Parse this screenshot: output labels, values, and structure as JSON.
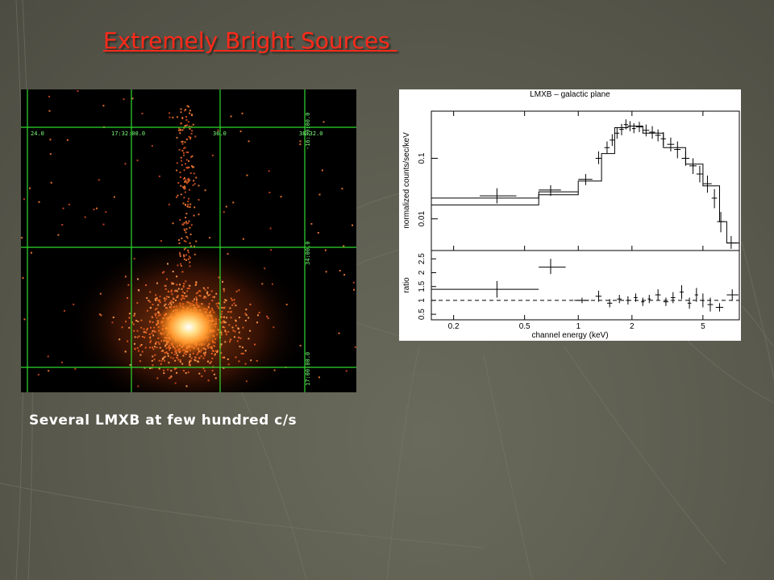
{
  "slide": {
    "title": "Extremely Bright Sources ",
    "caption": "Several LMXB at few hundred c/s",
    "colors": {
      "title": "#ff2a1a",
      "caption": "#ffffff",
      "background": "#5a5a4e",
      "grid": "#2ed82e"
    }
  },
  "xray_image": {
    "top_labels": [
      "24.0",
      "17:32:00.0",
      "36.0",
      "38:32.0"
    ],
    "right_labels": [
      "-16:30:00.0",
      "34:00.0",
      "17:00:00.0"
    ]
  },
  "chart_data": {
    "type": "scatter",
    "title": "LMXB – galactic plane",
    "xlabel": "channel energy (keV)",
    "upper_panel": {
      "ylabel": "normalized counts/sec/keV",
      "yscale": "log",
      "ylim": [
        0.003,
        0.6
      ],
      "ytick_labels": [
        "0.01",
        "0.1"
      ],
      "xlim": [
        0.15,
        8
      ],
      "xscale": "log",
      "model_step_1": [
        {
          "x0": 0.15,
          "x1": 0.6,
          "y": 0.017
        },
        {
          "x0": 0.6,
          "x1": 1.0,
          "y": 0.025
        },
        {
          "x0": 1.0,
          "x1": 1.35,
          "y": 0.042
        },
        {
          "x0": 1.35,
          "x1": 1.6,
          "y": 0.12
        },
        {
          "x0": 1.6,
          "x1": 1.9,
          "y": 0.32
        },
        {
          "x0": 1.9,
          "x1": 2.3,
          "y": 0.34
        },
        {
          "x0": 2.3,
          "x1": 3.0,
          "y": 0.26
        },
        {
          "x0": 3.0,
          "x1": 4.0,
          "y": 0.15
        },
        {
          "x0": 4.0,
          "x1": 5.0,
          "y": 0.08
        },
        {
          "x0": 5.0,
          "x1": 6.2,
          "y": 0.035
        },
        {
          "x0": 6.2,
          "x1": 6.8,
          "y": 0.009
        },
        {
          "x0": 6.8,
          "x1": 8.0,
          "y": 0.004
        }
      ],
      "model_step_2": [
        {
          "x0": 0.15,
          "x1": 0.6,
          "y": 0.022
        },
        {
          "x0": 0.6,
          "x1": 1.0,
          "y": 0.028
        }
      ],
      "points": [
        {
          "x": 0.35,
          "y": 0.024,
          "xerr": [
            0.28,
            0.45
          ],
          "yerr": [
            0.018,
            0.032
          ]
        },
        {
          "x": 0.7,
          "y": 0.03,
          "xerr": [
            0.6,
            0.8
          ],
          "yerr": [
            0.024,
            0.036
          ]
        },
        {
          "x": 1.1,
          "y": 0.045,
          "xerr": [
            1.0,
            1.2
          ],
          "yerr": [
            0.036,
            0.055
          ]
        },
        {
          "x": 1.3,
          "y": 0.1,
          "xerr": [
            1.25,
            1.35
          ],
          "yerr": [
            0.08,
            0.13
          ]
        },
        {
          "x": 1.45,
          "y": 0.15,
          "xerr": [
            1.4,
            1.5
          ],
          "yerr": [
            0.12,
            0.19
          ]
        },
        {
          "x": 1.55,
          "y": 0.2,
          "xerr": [
            1.5,
            1.6
          ],
          "yerr": [
            0.16,
            0.25
          ]
        },
        {
          "x": 1.65,
          "y": 0.26,
          "xerr": [
            1.6,
            1.7
          ],
          "yerr": [
            0.21,
            0.32
          ]
        },
        {
          "x": 1.75,
          "y": 0.3,
          "xerr": [
            1.7,
            1.8
          ],
          "yerr": [
            0.24,
            0.37
          ]
        },
        {
          "x": 1.85,
          "y": 0.36,
          "xerr": [
            1.8,
            1.9
          ],
          "yerr": [
            0.3,
            0.44
          ]
        },
        {
          "x": 1.95,
          "y": 0.34,
          "xerr": [
            1.9,
            2.0
          ],
          "yerr": [
            0.28,
            0.41
          ]
        },
        {
          "x": 2.05,
          "y": 0.31,
          "xerr": [
            2.0,
            2.1
          ],
          "yerr": [
            0.26,
            0.38
          ]
        },
        {
          "x": 2.2,
          "y": 0.33,
          "xerr": [
            2.1,
            2.3
          ],
          "yerr": [
            0.27,
            0.4
          ]
        },
        {
          "x": 2.4,
          "y": 0.29,
          "xerr": [
            2.3,
            2.5
          ],
          "yerr": [
            0.23,
            0.36
          ]
        },
        {
          "x": 2.6,
          "y": 0.27,
          "xerr": [
            2.5,
            2.7
          ],
          "yerr": [
            0.21,
            0.34
          ]
        },
        {
          "x": 2.8,
          "y": 0.24,
          "xerr": [
            2.7,
            2.9
          ],
          "yerr": [
            0.19,
            0.3
          ]
        },
        {
          "x": 3.0,
          "y": 0.21,
          "xerr": [
            2.9,
            3.1
          ],
          "yerr": [
            0.16,
            0.27
          ]
        },
        {
          "x": 3.3,
          "y": 0.17,
          "xerr": [
            3.15,
            3.45
          ],
          "yerr": [
            0.13,
            0.22
          ]
        },
        {
          "x": 3.6,
          "y": 0.14,
          "xerr": [
            3.45,
            3.75
          ],
          "yerr": [
            0.1,
            0.19
          ]
        },
        {
          "x": 4.0,
          "y": 0.1,
          "xerr": [
            3.8,
            4.2
          ],
          "yerr": [
            0.075,
            0.13
          ]
        },
        {
          "x": 4.4,
          "y": 0.075,
          "xerr": [
            4.2,
            4.6
          ],
          "yerr": [
            0.055,
            0.1
          ]
        },
        {
          "x": 4.8,
          "y": 0.055,
          "xerr": [
            4.6,
            5.0
          ],
          "yerr": [
            0.04,
            0.075
          ]
        },
        {
          "x": 5.3,
          "y": 0.038,
          "xerr": [
            5.0,
            5.6
          ],
          "yerr": [
            0.027,
            0.052
          ]
        },
        {
          "x": 5.8,
          "y": 0.022,
          "xerr": [
            5.6,
            6.0
          ],
          "yerr": [
            0.015,
            0.031
          ]
        },
        {
          "x": 6.3,
          "y": 0.009,
          "xerr": [
            6.0,
            6.6
          ],
          "yerr": [
            0.006,
            0.013
          ]
        },
        {
          "x": 7.2,
          "y": 0.004,
          "xerr": [
            6.8,
            7.8
          ],
          "yerr": [
            0.0032,
            0.0052
          ]
        }
      ]
    },
    "lower_panel": {
      "ylabel": "ratio",
      "ylim": [
        0.3,
        2.8
      ],
      "ytick_labels": [
        "0.5",
        "1",
        "1.5",
        "2",
        "2.5"
      ],
      "yticks": [
        0.5,
        1,
        1.5,
        2,
        2.5
      ],
      "reference_line": 1,
      "points": [
        {
          "x": 0.35,
          "y": 1.4,
          "xerr": [
            0.15,
            0.6
          ],
          "yerr": [
            1.1,
            1.7
          ]
        },
        {
          "x": 0.7,
          "y": 2.2,
          "xerr": [
            0.6,
            0.85
          ],
          "yerr": [
            1.95,
            2.5
          ]
        },
        {
          "x": 1.05,
          "y": 1.0,
          "xerr": [
            0.95,
            1.15
          ],
          "yerr": [
            0.9,
            1.1
          ]
        },
        {
          "x": 1.3,
          "y": 1.15,
          "xerr": [
            1.25,
            1.35
          ],
          "yerr": [
            0.95,
            1.35
          ]
        },
        {
          "x": 1.5,
          "y": 0.9,
          "xerr": [
            1.45,
            1.55
          ],
          "yerr": [
            0.75,
            1.05
          ]
        },
        {
          "x": 1.7,
          "y": 1.05,
          "xerr": [
            1.65,
            1.75
          ],
          "yerr": [
            0.9,
            1.2
          ]
        },
        {
          "x": 1.9,
          "y": 1.0,
          "xerr": [
            1.85,
            1.95
          ],
          "yerr": [
            0.85,
            1.15
          ]
        },
        {
          "x": 2.1,
          "y": 1.1,
          "xerr": [
            2.05,
            2.15
          ],
          "yerr": [
            0.95,
            1.25
          ]
        },
        {
          "x": 2.3,
          "y": 0.95,
          "xerr": [
            2.25,
            2.35
          ],
          "yerr": [
            0.8,
            1.1
          ]
        },
        {
          "x": 2.5,
          "y": 1.05,
          "xerr": [
            2.45,
            2.55
          ],
          "yerr": [
            0.9,
            1.2
          ]
        },
        {
          "x": 2.8,
          "y": 1.2,
          "xerr": [
            2.7,
            2.9
          ],
          "yerr": [
            1.0,
            1.4
          ]
        },
        {
          "x": 3.1,
          "y": 0.95,
          "xerr": [
            3.0,
            3.2
          ],
          "yerr": [
            0.8,
            1.1
          ]
        },
        {
          "x": 3.4,
          "y": 1.1,
          "xerr": [
            3.3,
            3.5
          ],
          "yerr": [
            0.9,
            1.3
          ]
        },
        {
          "x": 3.8,
          "y": 1.3,
          "xerr": [
            3.7,
            3.9
          ],
          "yerr": [
            1.05,
            1.55
          ]
        },
        {
          "x": 4.2,
          "y": 0.9,
          "xerr": [
            4.1,
            4.3
          ],
          "yerr": [
            0.7,
            1.1
          ]
        },
        {
          "x": 4.6,
          "y": 1.2,
          "xerr": [
            4.5,
            4.7
          ],
          "yerr": [
            0.95,
            1.45
          ]
        },
        {
          "x": 5.0,
          "y": 1.0,
          "xerr": [
            4.9,
            5.1
          ],
          "yerr": [
            0.75,
            1.25
          ]
        },
        {
          "x": 5.5,
          "y": 0.85,
          "xerr": [
            5.3,
            5.7
          ],
          "yerr": [
            0.6,
            1.1
          ]
        },
        {
          "x": 6.2,
          "y": 0.75,
          "xerr": [
            5.9,
            6.5
          ],
          "yerr": [
            0.6,
            0.9
          ]
        },
        {
          "x": 7.3,
          "y": 1.2,
          "xerr": [
            6.8,
            7.9
          ],
          "yerr": [
            1.0,
            1.4
          ]
        }
      ]
    },
    "xtick_labels": [
      "0.2",
      "0.5",
      "1",
      "2",
      "5"
    ],
    "xticks": [
      0.2,
      0.5,
      1,
      2,
      5
    ]
  }
}
